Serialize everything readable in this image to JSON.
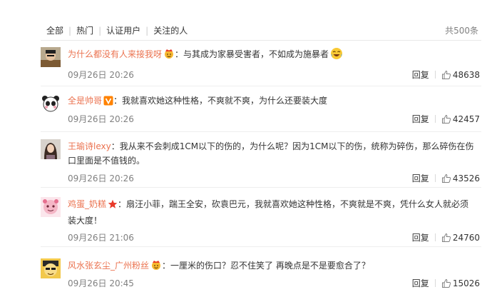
{
  "filters": {
    "all": "全部",
    "hot": "热门",
    "verified": "认证用户",
    "following": "关注的人",
    "separator": "|",
    "total": "共500条"
  },
  "actions": {
    "reply_label": "回复"
  },
  "colors": {
    "username": "#eb7350",
    "meta": "#808080",
    "text": "#333333",
    "vip_badge": "#ff8200",
    "star_badge": "#e8392a"
  },
  "comments": [
    {
      "username": "为什么都没有人来接我呀",
      "badge": "crown-face-icon",
      "colon": "：",
      "text": "与其成为家暴受害者，不如成为施暴者",
      "emoji": "laughing-tears-emoji-icon",
      "time": "09月26日 20:26",
      "likes": "48638"
    },
    {
      "username": "全是帅哥",
      "badge": "vip-v-icon",
      "colon": "：",
      "text": "我就喜欢她这种性格，不爽就不爽，为什么还要装大度",
      "time": "09月26日 20:26",
      "likes": "42457"
    },
    {
      "username": "王瑜诗lexy",
      "badge": "",
      "colon": "：",
      "text": "我从来不会刺成1CM以下的伤的，为什么呢？因为1CM以下的伤，统称为碎伤，那么碎伤在伤口里面是不值钱的。",
      "time": "09月26日 20:26",
      "likes": "43526"
    },
    {
      "username": "鸡蛋_奶糕",
      "badge": "star-icon",
      "colon": "：",
      "text": "扇汪小菲，踹王全安，砍袁巴元，我就喜欢她这种性格，不爽就是不爽，凭什么女人就必须装大度！",
      "time": "09月26日 21:06",
      "likes": "24760"
    },
    {
      "username": "风水张玄尘_广州粉丝",
      "badge": "crown-face-icon",
      "colon": "：",
      "text": "一厘米的伤口？忍不住笑了 再晚点是不是要愈合了？",
      "time": "09月26日 20:45",
      "likes": "15026"
    }
  ]
}
